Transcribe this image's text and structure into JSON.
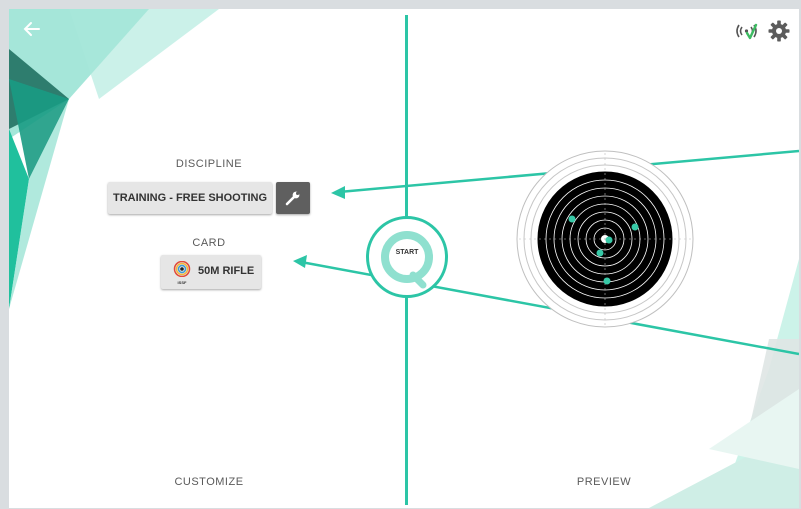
{
  "colors": {
    "accent": "#2cc5a6",
    "dark_button": "#5f5f5f",
    "light_button": "#e6e6e6",
    "target_black": "#000000"
  },
  "header": {
    "back_icon": "arrow-left-icon",
    "status_icon": "wireless-signal-icon",
    "settings_icon": "gear-icon"
  },
  "left_panel": {
    "discipline_label": "DISCIPLINE",
    "discipline_value": "TRAINING - FREE SHOOTING",
    "discipline_edit_icon": "wrench-icon",
    "card_label": "CARD",
    "card_value": "50M RIFLE",
    "card_icon": "target-logo-icon",
    "card_icon_caption": "ISSF",
    "footer_label": "CUSTOMIZE"
  },
  "center": {
    "start_label": "START"
  },
  "right_panel": {
    "footer_label": "PREVIEW"
  }
}
